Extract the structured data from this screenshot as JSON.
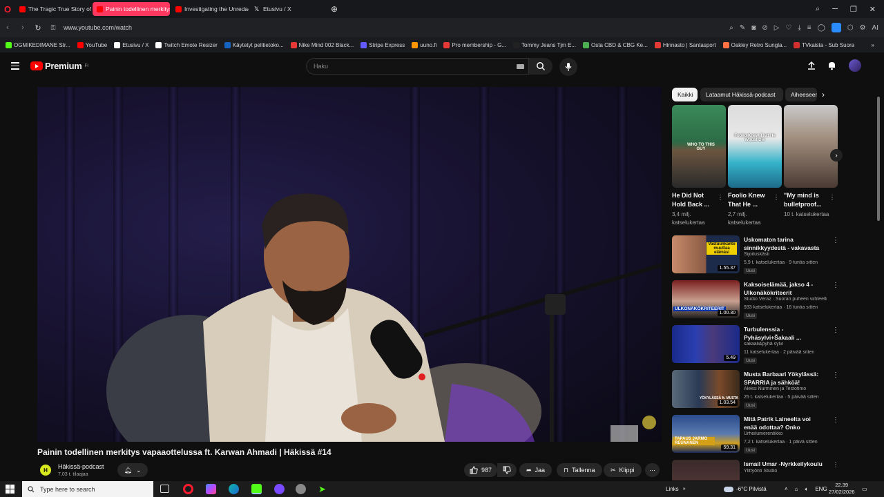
{
  "browser": {
    "tabs": [
      {
        "title": "The Tragic True Story of Ju",
        "active": false,
        "icon_color": "#ff0000"
      },
      {
        "title": "Painin todellinen merkitys",
        "active": true,
        "icon_color": "#ff0000"
      },
      {
        "title": "Investigating the Unredact",
        "active": false,
        "icon_color": "#ff0000"
      },
      {
        "title": "Etusivu / X",
        "active": false,
        "icon_color": "#ffffff"
      }
    ],
    "url": "www.youtube.com/watch",
    "ai_label": "AI",
    "bookmarks": [
      {
        "label": "OGMIKEDIMANE Str...",
        "color": "#53fc18"
      },
      {
        "label": "YouTube",
        "color": "#ff0000"
      },
      {
        "label": "Etusivu / X",
        "color": "#ffffff"
      },
      {
        "label": "Twitch Emote Resizer",
        "color": "#ffffff"
      },
      {
        "label": "Käytetyt pelitietoko...",
        "color": "#1565c0"
      },
      {
        "label": "Nike Mind 002 Black...",
        "color": "#e53935"
      },
      {
        "label": "Stripe Express",
        "color": "#635bff"
      },
      {
        "label": "uuno.fi",
        "color": "#ff9800"
      },
      {
        "label": "Pro membership - G...",
        "color": "#e53935"
      },
      {
        "label": "Tommy Jeans Tjm E...",
        "color": "#222222"
      },
      {
        "label": "Osta CBD & CBG Ke...",
        "color": "#4caf50"
      },
      {
        "label": "Hinnasto | Santasport",
        "color": "#e53935"
      },
      {
        "label": "Oakley Retro Sungla...",
        "color": "#ff7043"
      },
      {
        "label": "TVkaista - Sub Suora",
        "color": "#d32f2f"
      }
    ]
  },
  "youtube": {
    "logo_text": "Premium",
    "logo_sup": "FI",
    "search_placeholder": "Haku",
    "video": {
      "title": "Painin todellinen merkitys vapaaottelussa ft. Karwan Ahmadi | Häkissä #14",
      "channel": "Häkissä-podcast",
      "subscribers": "7,03 t. tilaajaa",
      "likes": "987",
      "share_label": "Jaa",
      "save_label": "Tallenna",
      "clip_label": "Klippi"
    },
    "chips": [
      "Kaikki",
      "Lataamut Häkissä-podcast",
      "Aiheeseen"
    ],
    "shorts": [
      {
        "title": "He Did Not Hold Back ...",
        "views": "3,4 milj. katselukertaa",
        "overlay": "WHO TO THIS GUY"
      },
      {
        "title": "Foolio Knew That He ...",
        "views": "2,7 milj. katselukertaa",
        "overlay": "Foolio Knew That He Would Die"
      },
      {
        "title": "\"My mind is bulletproof...",
        "views": "10 t. katselukertaa",
        "overlay": ""
      }
    ],
    "videos": [
      {
        "title": "Uskomaton tarina sinnikkyydestä - vakavasta ...",
        "channel": "Sijoituskästi",
        "meta": "5,9 t. katselukertaa · 9 tuntia sitten",
        "new": "Uusi",
        "duration": "1.55.37",
        "thumb_text": "Vastuunkanto muuttaa elämäsi"
      },
      {
        "title": "Kaksoiselämää, jakso 4 - Ulkonäkökriteerit",
        "channel": "Studio Veraz · Suoran puheen viihteelli...",
        "meta": "933 katselukertaa · 16 tuntia sitten",
        "new": "Uusi",
        "duration": "1.00.30",
        "thumb_text": "ULKONÄKÖKRITEERIT"
      },
      {
        "title": "Turbulenssia - Pyhäsylvi+Šakaali ...",
        "channel": "sakaali&pyhä sylvi",
        "meta": "11 katselukertaa · 2 päivää sitten",
        "new": "Uusi",
        "duration": "5.49",
        "thumb_text": ""
      },
      {
        "title": "Musta Barbaari Yökylässä: SPARRIA ja sähköä!",
        "channel": "Aleksi Nurminen ja Testotimo",
        "meta": "25 t. katselukertaa · 5 päivää sitten",
        "new": "Uusi",
        "duration": "1.03.54",
        "thumb_text": "YÖKYLÄSSÄ ft. MUSTA"
      },
      {
        "title": "Mitä Patrik Laineelta voi enää odottaa? Onko McDavid ...",
        "channel": "Urheilumerentikko",
        "meta": "7,2 t. katselukertaa · 1 päivä sitten",
        "new": "Uusi",
        "duration": "59.31",
        "thumb_text": "TAPAUS JARMO REUNANEN"
      },
      {
        "title": "Ismail Umar -Nyrkkeilykoulu",
        "channel": "Ylittyönti Studio",
        "meta": "",
        "new": "",
        "duration": "",
        "thumb_text": ""
      }
    ]
  },
  "taskbar": {
    "search_placeholder": "Type here to search",
    "links_label": "Links",
    "weather": "-6°C  Pilvistä",
    "language": "ENG",
    "time": "22.39",
    "date": "27/02/2026"
  },
  "colors": {
    "accent_tab": "#ff3860",
    "youtube_red": "#ff0000",
    "bg": "#0f0f0f"
  }
}
